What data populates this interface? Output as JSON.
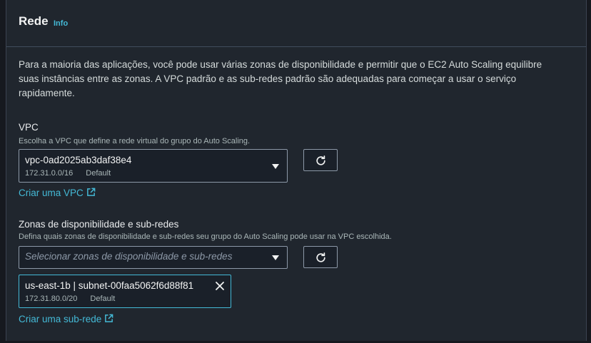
{
  "section": {
    "title": "Rede",
    "info_label": "Info",
    "description": "Para a maioria das aplicações, você pode usar várias zonas de disponibilidade e permitir que o EC2 Auto Scaling equilibre suas instâncias entre as zonas. A VPC padrão e as sub-redes padrão são adequadas para começar a usar o serviço rapidamente."
  },
  "vpc": {
    "label": "VPC",
    "hint": "Escolha a VPC que define a rede virtual do grupo do Auto Scaling.",
    "selected_id": "vpc-0ad2025ab3daf38e4",
    "selected_cidr": "172.31.0.0/16",
    "selected_tag": "Default",
    "create_link": "Criar uma VPC"
  },
  "subnets": {
    "label": "Zonas de disponibilidade e sub-redes",
    "hint": "Defina quais zonas de disponibilidade e sub-redes seu grupo do Auto Scaling pode usar na VPC escolhida.",
    "placeholder": "Selecionar zonas de disponibilidade e sub-redes",
    "tokens": [
      {
        "title": "us-east-1b | subnet-00faa5062f6d88f81",
        "cidr": "172.31.80.0/20",
        "tag": "Default"
      }
    ],
    "create_link": "Criar uma sub-rede"
  },
  "icons": {
    "refresh": "refresh-icon",
    "external": "external-link-icon",
    "caret": "caret-down-icon",
    "close": "close-icon"
  },
  "colors": {
    "accent": "#44b9d6",
    "border": "#8d99a8",
    "text": "#d5dbdb"
  }
}
